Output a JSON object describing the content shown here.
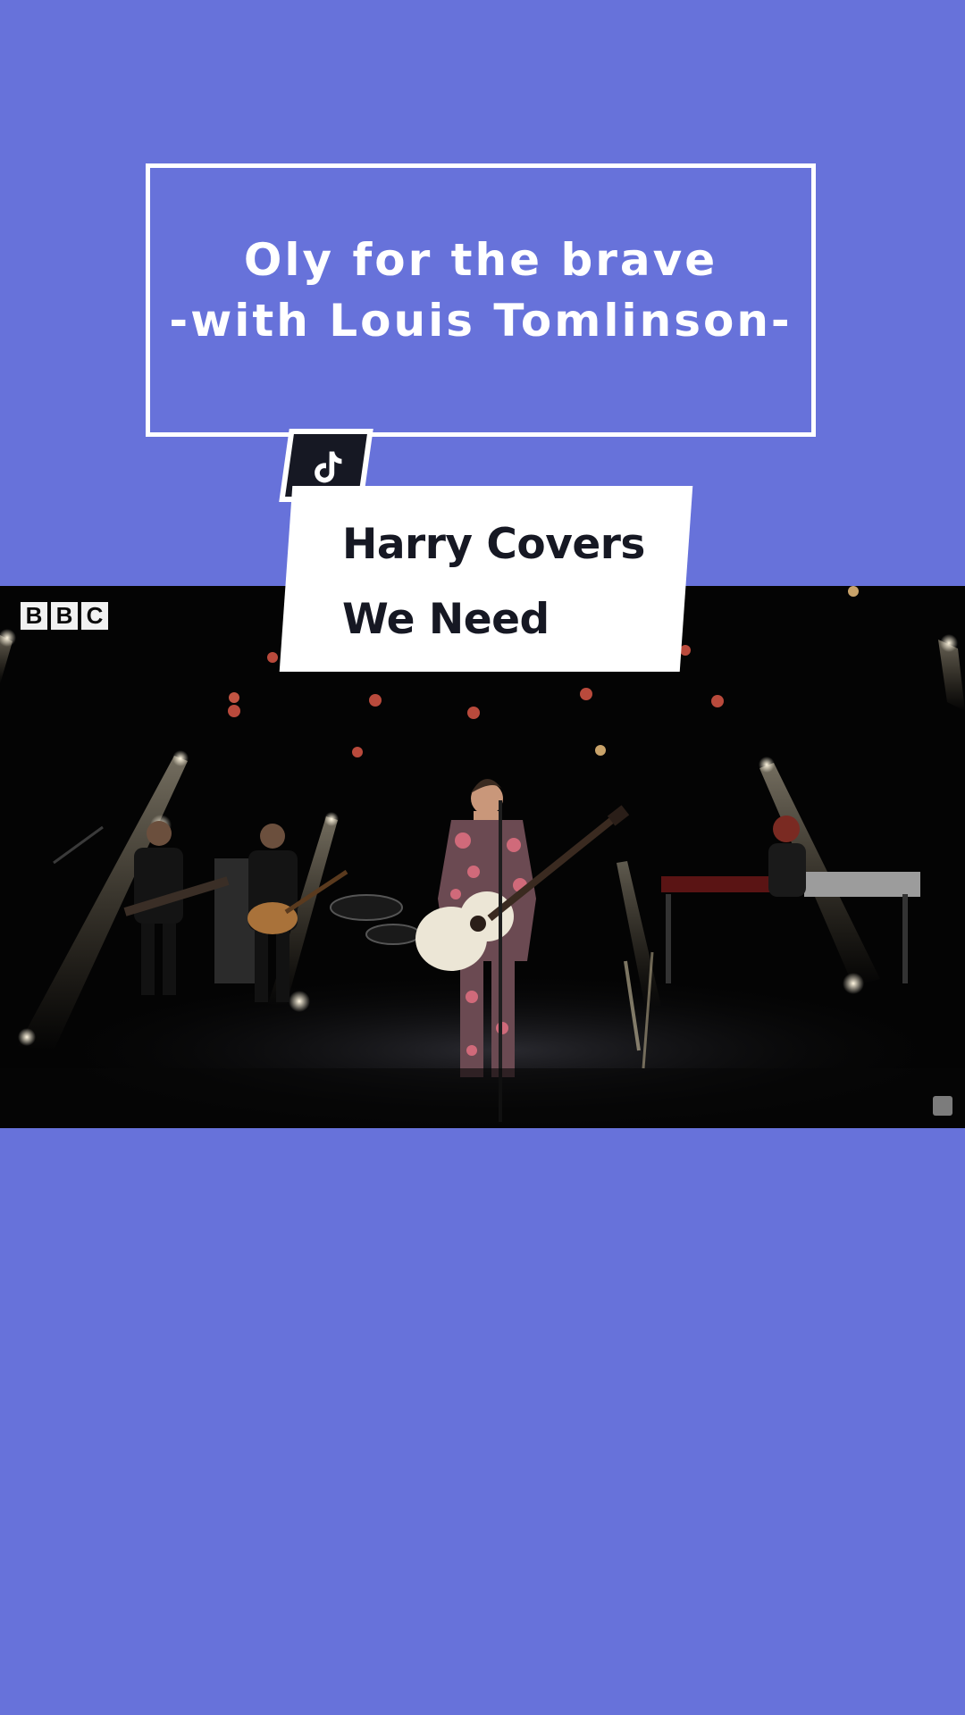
{
  "title_box": {
    "line1": "Oly for the brave",
    "line2": "-with Louis Tomlinson-"
  },
  "card": {
    "line1": "Harry Covers",
    "line2": "We Need"
  },
  "video": {
    "watermark": [
      "B",
      "B",
      "C"
    ]
  },
  "icons": {
    "tiktok": "tiktok-logo-icon",
    "corner": "channel-badge-icon"
  },
  "colors": {
    "background": "#6772da",
    "text_dark": "#161823",
    "white": "#ffffff"
  }
}
